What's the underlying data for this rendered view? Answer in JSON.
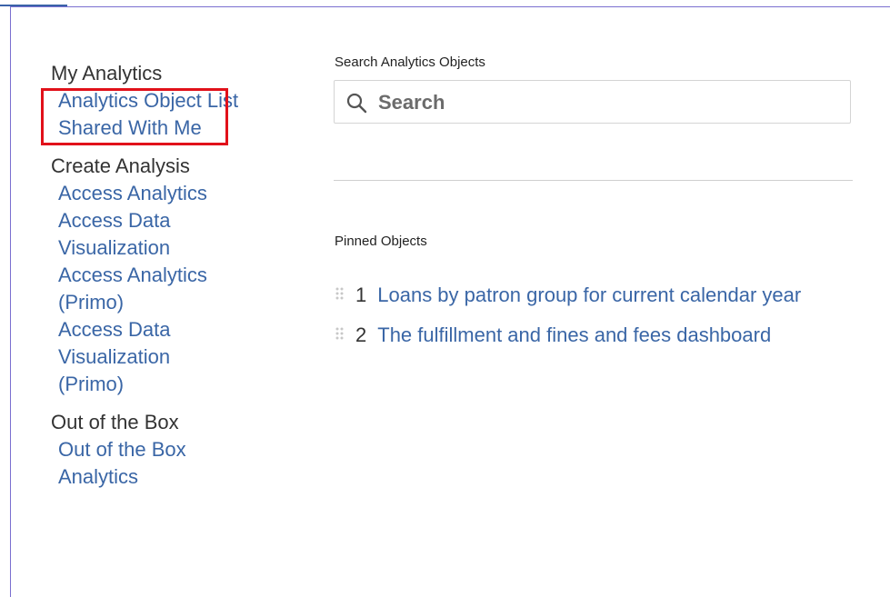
{
  "sidebar": {
    "my_analytics": {
      "heading": "My Analytics",
      "links": [
        "Analytics Object List",
        "Shared With Me"
      ]
    },
    "create_analysis": {
      "heading": "Create Analysis",
      "links": [
        "Access Analytics",
        "Access Data Visualization",
        "Access Analytics (Primo)",
        "Access Data Visualization (Primo)"
      ]
    },
    "out_of_the_box": {
      "heading": "Out of the Box",
      "links": [
        "Out of the Box Analytics"
      ]
    }
  },
  "search": {
    "label": "Search Analytics Objects",
    "placeholder": "Search",
    "value": ""
  },
  "pinned": {
    "label": "Pinned Objects",
    "items": [
      {
        "number": "1",
        "title": "Loans by patron group for current calendar year"
      },
      {
        "number": "2",
        "title": "The fulfillment and fines and fees dashboard"
      }
    ]
  },
  "colors": {
    "link": "#3a66a6",
    "highlight": "#e1111a",
    "frame": "#7a6fd0"
  }
}
